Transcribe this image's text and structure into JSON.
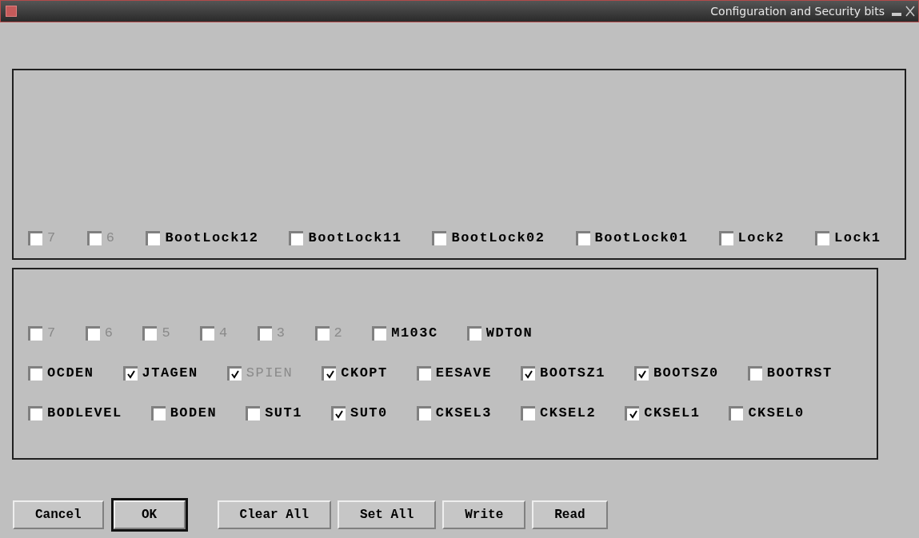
{
  "window": {
    "title": "Configuration and Security bits"
  },
  "lock_bits": [
    {
      "label": "7",
      "checked": false,
      "disabled": true
    },
    {
      "label": "6",
      "checked": false,
      "disabled": true
    },
    {
      "label": "BootLock12",
      "checked": false,
      "disabled": false
    },
    {
      "label": "BootLock11",
      "checked": false,
      "disabled": false
    },
    {
      "label": "BootLock02",
      "checked": false,
      "disabled": false
    },
    {
      "label": "BootLock01",
      "checked": false,
      "disabled": false
    },
    {
      "label": "Lock2",
      "checked": false,
      "disabled": false
    },
    {
      "label": "Lock1",
      "checked": false,
      "disabled": false
    }
  ],
  "fuse_rows": [
    [
      {
        "label": "7",
        "checked": false,
        "disabled": true
      },
      {
        "label": "6",
        "checked": false,
        "disabled": true
      },
      {
        "label": "5",
        "checked": false,
        "disabled": true
      },
      {
        "label": "4",
        "checked": false,
        "disabled": true
      },
      {
        "label": "3",
        "checked": false,
        "disabled": true
      },
      {
        "label": "2",
        "checked": false,
        "disabled": true
      },
      {
        "label": "M103C",
        "checked": false,
        "disabled": false
      },
      {
        "label": "WDTON",
        "checked": false,
        "disabled": false
      }
    ],
    [
      {
        "label": "OCDEN",
        "checked": false,
        "disabled": false
      },
      {
        "label": "JTAGEN",
        "checked": true,
        "disabled": false
      },
      {
        "label": "SPIEN",
        "checked": true,
        "disabled": true
      },
      {
        "label": "CKOPT",
        "checked": true,
        "disabled": false
      },
      {
        "label": "EESAVE",
        "checked": false,
        "disabled": false
      },
      {
        "label": "BOOTSZ1",
        "checked": true,
        "disabled": false
      },
      {
        "label": "BOOTSZ0",
        "checked": true,
        "disabled": false
      },
      {
        "label": "BOOTRST",
        "checked": false,
        "disabled": false
      }
    ],
    [
      {
        "label": "BODLEVEL",
        "checked": false,
        "disabled": false
      },
      {
        "label": "BODEN",
        "checked": false,
        "disabled": false
      },
      {
        "label": "SUT1",
        "checked": false,
        "disabled": false
      },
      {
        "label": "SUT0",
        "checked": true,
        "disabled": false
      },
      {
        "label": "CKSEL3",
        "checked": false,
        "disabled": false
      },
      {
        "label": "CKSEL2",
        "checked": false,
        "disabled": false
      },
      {
        "label": "CKSEL1",
        "checked": true,
        "disabled": false
      },
      {
        "label": "CKSEL0",
        "checked": false,
        "disabled": false
      }
    ]
  ],
  "buttons": [
    {
      "label": "Cancel",
      "default": false
    },
    {
      "label": "OK",
      "default": true
    },
    {
      "label": "Clear All",
      "default": false
    },
    {
      "label": "Set All",
      "default": false
    },
    {
      "label": "Write",
      "default": false
    },
    {
      "label": "Read",
      "default": false
    }
  ]
}
